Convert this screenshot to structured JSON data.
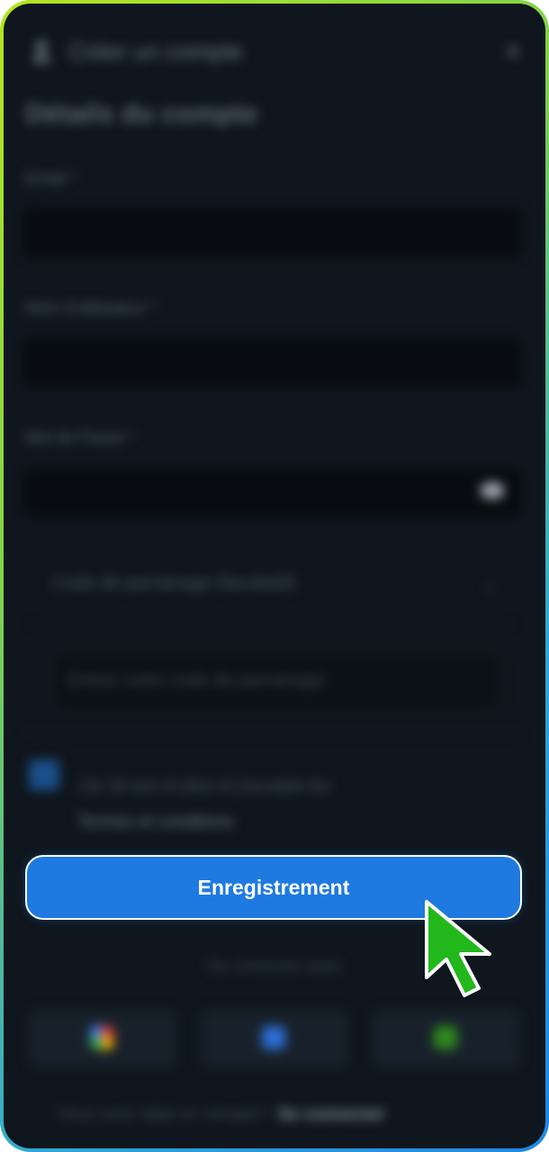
{
  "header": {
    "title": "Créer un compte",
    "app_icon": "user-icon",
    "close_icon": "close-icon"
  },
  "form": {
    "section_title": "Détails du compte",
    "email_label": "Email *",
    "username_label": "Nom d'utilisateur *",
    "password_label": "Mot de Passe *",
    "referral_select_label": "Code de parrainage (facultatif)",
    "referral_input_placeholder": "Entrez votre code de parrainage",
    "terms_text": "J'ai 18 ans et plus et j'accepte les",
    "terms_link": "Termes et conditions"
  },
  "register_button": {
    "label": "Enregistrement"
  },
  "social": {
    "or_text": "Ou s'inscrire avec",
    "providers": [
      "google-icon",
      "facebook-icon",
      "telegram-icon"
    ]
  },
  "footer": {
    "text": "Vous avez déjà un compte?",
    "link": "Se connecter"
  },
  "colors": {
    "primary": "#1e7ae0",
    "background": "#0f161d",
    "cursor": "#22b81c"
  }
}
